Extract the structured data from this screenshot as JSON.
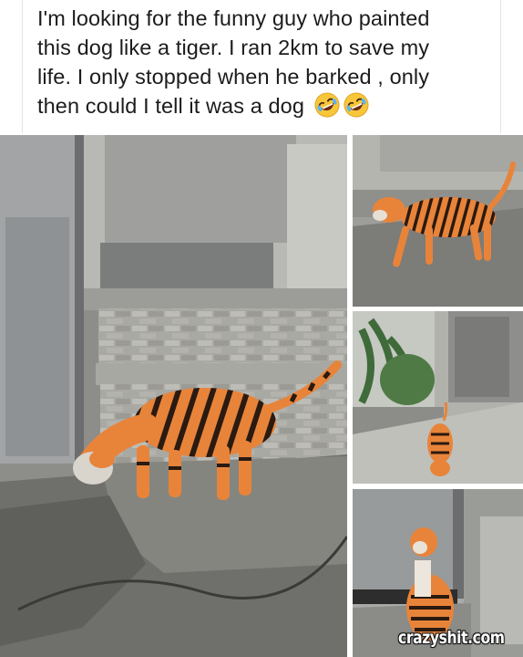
{
  "caption": {
    "lines": [
      "I'm looking for the funny guy who painted",
      "this dog like a tiger. I ran 2km to save my",
      "life. I only stopped when he barked , only",
      "then could I tell it was a dog"
    ],
    "emojis": [
      "rolling-on-floor-laughing-icon",
      "rolling-on-floor-laughing-icon"
    ]
  },
  "photos": [
    {
      "name": "tiger-painted-dog-on-steps"
    },
    {
      "name": "tiger-painted-dog-walking"
    },
    {
      "name": "tiger-painted-dog-in-alley"
    },
    {
      "name": "tiger-painted-dog-sitting"
    }
  ],
  "watermark": "crazyshit.com",
  "colors": {
    "tiger_orange": "#e8843a",
    "stripe": "#2a1a10",
    "text": "#1c1c1c"
  }
}
